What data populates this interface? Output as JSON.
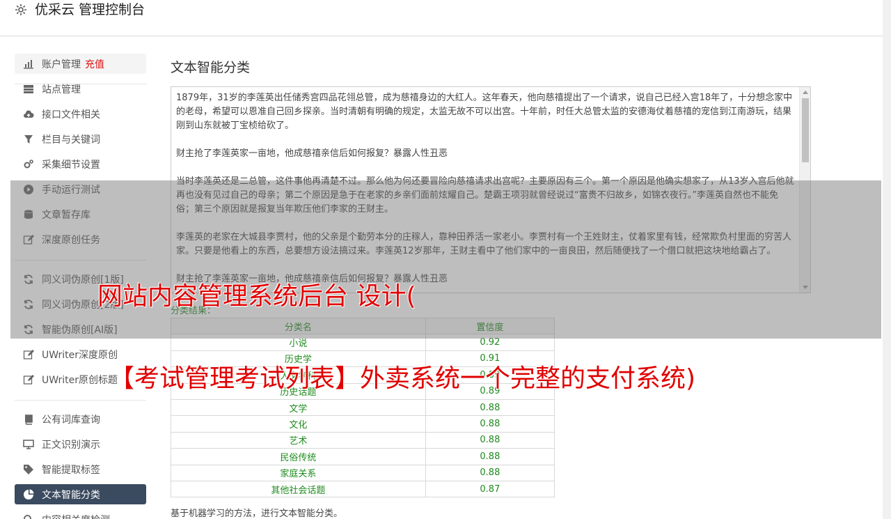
{
  "header": {
    "title": "优采云 管理控制台"
  },
  "sidebar": {
    "items": [
      {
        "label": "账户管理",
        "recharge": "充值",
        "icon": "bar-chart-icon"
      },
      {
        "label": "站点管理",
        "icon": "server-icon"
      },
      {
        "label": "接口文件相关",
        "icon": "cloud-upload-icon"
      },
      {
        "label": "栏目与关键词",
        "icon": "filter-icon"
      },
      {
        "label": "采集细节设置",
        "icon": "gears-icon"
      },
      {
        "label": "手动运行测试",
        "icon": "play-icon"
      },
      {
        "label": "文章暂存库",
        "icon": "database-icon"
      },
      {
        "label": "深度原创任务",
        "icon": "edit-icon"
      },
      {
        "label": "同义词伪原创[1版]",
        "icon": "refresh-icon"
      },
      {
        "label": "同义词伪原创[2版]",
        "icon": "refresh-icon"
      },
      {
        "label": "智能伪原创[AI版]",
        "icon": "refresh-icon"
      },
      {
        "label": "UWriter深度原创",
        "icon": "edit-icon"
      },
      {
        "label": "UWriter原创标题",
        "icon": "edit-icon"
      },
      {
        "label": "公有词库查询",
        "icon": "book-icon"
      },
      {
        "label": "正文识别演示",
        "icon": "desktop-icon"
      },
      {
        "label": "智能提取标签",
        "icon": "tag-icon"
      },
      {
        "label": "文本智能分类",
        "icon": "pie-chart-icon"
      },
      {
        "label": "内容相关度检测",
        "icon": "search-icon"
      }
    ]
  },
  "main": {
    "title": "文本智能分类",
    "paragraphs": [
      "1879年，31岁的李莲英出任储秀宫四品花翎总管，成为慈禧身边的大红人。这年春天，他向慈禧提出了一个请求，说自己已经入宫18年了，十分想念家中的老母，希望可以恩准自己回乡探亲。当时清朝有明确的规定，太监无故不可以出宫。十年前，时任大总管太监的安德海仗着慈禧的宠信到江南游玩，结果刚到山东就被丁宝桢给砍了。",
      "财主抢了李莲英家一亩地，他成慈禧亲信后如何报复？暴露人性丑恶",
      "当时李莲英还是二总管，这件事他再清楚不过。那么他为何还要冒险向慈禧请求出宫呢？主要原因有三个。第一个原因是他确实想家了，从13岁入宫后他就再也没有见过自己的母亲；第二个原因是急于在老家的乡亲们面前炫耀自己。楚霸王项羽就曾经说过“富贵不归故乡，如锦衣夜行。”李莲英自然也不能免俗；第三个原因就是报复当年欺压他们李家的王财主。",
      "李莲英的老家在大城县李贾村，他的父亲是个勤劳本分的庄稼人，靠种田养活一家老小。李贾村有一个王姓财主，仗着家里有钱，经常欺负村里面的穷苦人家。只要是他看上的东西，总要想方设法搞过来。李莲英12岁那年，王财主看中了他们家中的一亩良田，然后随便找了一个借口就把这块地给霸占了。",
      "财主抢了李莲英家一亩地，他成慈禧亲信后如何报复？暴露人性丑恶"
    ],
    "result_label": "分类结果：",
    "table": {
      "headers": [
        "分类名",
        "置信度"
      ],
      "rows": [
        [
          "小说",
          "0.92"
        ],
        [
          "历史学",
          "0.91"
        ],
        [
          "人文学科",
          "0.89"
        ],
        [
          "历史话题",
          "0.89"
        ],
        [
          "文学",
          "0.88"
        ],
        [
          "文化",
          "0.88"
        ],
        [
          "艺术",
          "0.88"
        ],
        [
          "民俗传统",
          "0.88"
        ],
        [
          "家庭关系",
          "0.88"
        ],
        [
          "其他社会话题",
          "0.87"
        ]
      ]
    },
    "footnote": "基于机器学习的方法，进行文本智能分类。"
  },
  "overlay": {
    "line1": "网站内容管理系统后台 设计(",
    "line2": "【考试管理考试列表】外卖系统一个完整的支付系统)"
  },
  "colors": {
    "active": "#3a4a5f",
    "recharge": "#dd1111",
    "result": "#1f8a1f",
    "overlay_text": "#e10000"
  }
}
